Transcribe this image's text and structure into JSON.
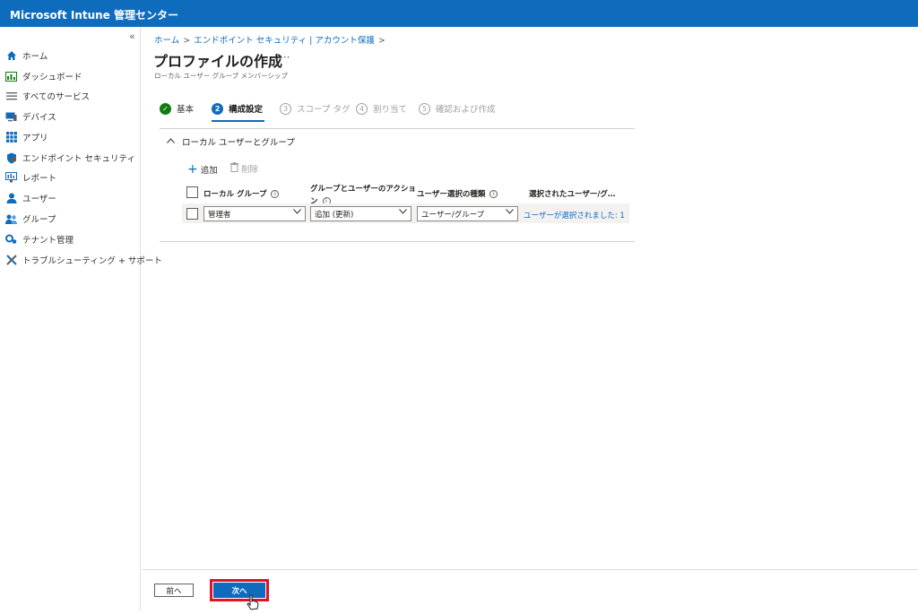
{
  "app": {
    "title": "Microsoft Intune 管理センター"
  },
  "sidebar": {
    "collapse": "«",
    "items": [
      {
        "label": "ホーム",
        "icon": "home-icon"
      },
      {
        "label": "ダッシュボード",
        "icon": "dashboard-icon"
      },
      {
        "label": "すべてのサービス",
        "icon": "list-icon"
      },
      {
        "label": "デバイス",
        "icon": "devices-icon"
      },
      {
        "label": "アプリ",
        "icon": "apps-grid-icon"
      },
      {
        "label": "エンドポイント セキュリティ",
        "icon": "shield-icon"
      },
      {
        "label": "レポート",
        "icon": "report-icon"
      },
      {
        "label": "ユーザー",
        "icon": "user-icon"
      },
      {
        "label": "グループ",
        "icon": "group-icon"
      },
      {
        "label": "テナント管理",
        "icon": "tenant-icon"
      },
      {
        "label": "トラブルシューティング + サポート",
        "icon": "wrench-icon"
      }
    ]
  },
  "breadcrumb": {
    "items": [
      "ホーム",
      "エンドポイント セキュリティ | アカウント保護"
    ],
    "sep": ">"
  },
  "page": {
    "title": "プロファイルの作成",
    "more": "···",
    "subtitle": "ローカル ユーザー グループ メンバーシップ"
  },
  "steps": [
    {
      "num": "✓",
      "label": "基本",
      "state": "done"
    },
    {
      "num": "2",
      "label": "構成設定",
      "state": "active"
    },
    {
      "num": "3",
      "label": "スコープ タグ",
      "state": "pending"
    },
    {
      "num": "4",
      "label": "割り当て",
      "state": "pending"
    },
    {
      "num": "5",
      "label": "確認および作成",
      "state": "pending"
    }
  ],
  "section": {
    "title": "ローカル ユーザーとグループ",
    "chevron": "^"
  },
  "commands": {
    "add": "追加",
    "delete": "削除"
  },
  "table": {
    "headers": {
      "local_group": "ローカル グループ",
      "action_line1": "グループとユーザーのアクショ",
      "action_line2": "ン",
      "selection_type": "ユーザー選択の種類",
      "selected": "選択されたユーザー/グ…"
    },
    "row": {
      "local_group": "管理者",
      "action": "追加 (更新)",
      "selection_type": "ユーザー/グループ",
      "selected": "ユーザーが選択されました: 1"
    }
  },
  "footer": {
    "prev": "前へ",
    "next": "次へ"
  },
  "colors": {
    "accent": "#0f6cbd",
    "highlight": "#e81123",
    "success": "#107c10"
  }
}
